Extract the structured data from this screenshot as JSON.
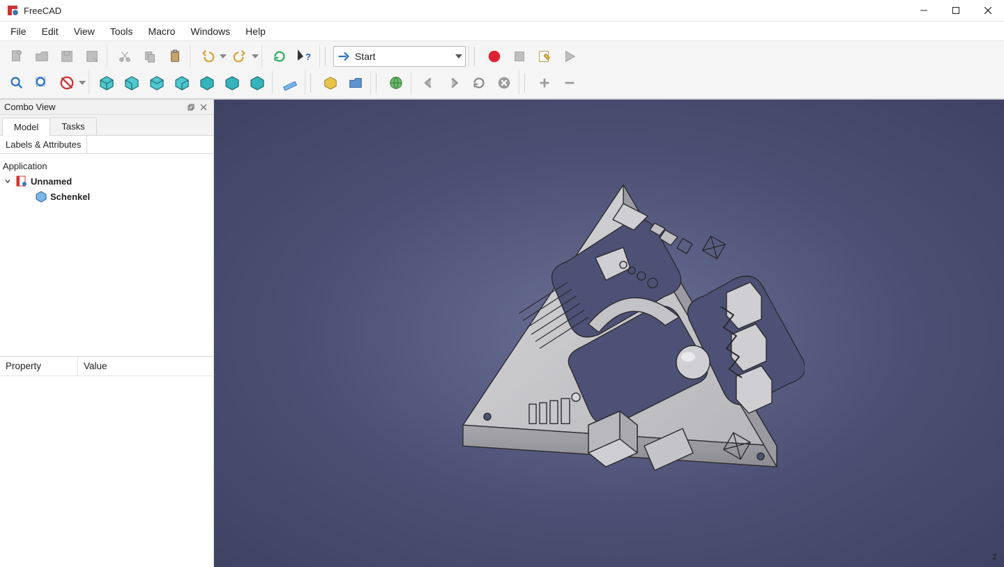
{
  "app": {
    "title": "FreeCAD"
  },
  "menubar": {
    "items": [
      "File",
      "Edit",
      "View",
      "Tools",
      "Macro",
      "Windows",
      "Help"
    ]
  },
  "workbench": {
    "selected": "Start"
  },
  "combo": {
    "panel_title": "Combo View",
    "tabs": {
      "model": "Model",
      "tasks": "Tasks"
    },
    "subtab": "Labels & Attributes",
    "tree": {
      "root": "Application",
      "doc": "Unnamed",
      "item": "Schenkel"
    },
    "props": {
      "property": "Property",
      "value": "Value"
    }
  },
  "axis": {
    "z": "z"
  },
  "icons": {
    "new": "new-icon",
    "open": "open-icon",
    "save": "save-icon",
    "saveas": "saveas-icon",
    "cut": "cut-icon",
    "copy": "copy-icon",
    "paste": "paste-icon",
    "undo": "undo-icon",
    "redo": "redo-icon",
    "refresh": "refresh-icon",
    "whatsthis": "whatsthis-icon",
    "macro_record": "record-icon",
    "macro_stop": "stop-icon",
    "macro_edit": "edit-macro-icon",
    "macro_play": "play-icon",
    "zoom_fit": "zoom-fit-icon",
    "zoom_sel": "zoom-selection-icon",
    "draw_style": "draw-style-icon",
    "iso": "iso-view-icon",
    "front": "front-view-icon",
    "top": "top-view-icon",
    "right": "right-view-icon",
    "rear": "rear-view-icon",
    "bottom": "bottom-view-icon",
    "left": "left-view-icon",
    "measure": "measure-icon",
    "part": "part-icon",
    "group": "group-icon",
    "web": "web-icon",
    "nav_back": "nav-back-icon",
    "nav_fwd": "nav-forward-icon",
    "nav_refresh": "nav-refresh-icon",
    "nav_stop": "nav-stop-icon",
    "zoom_in": "zoom-in-icon",
    "zoom_out": "zoom-out-icon",
    "arrow": "start-arrow-icon"
  }
}
